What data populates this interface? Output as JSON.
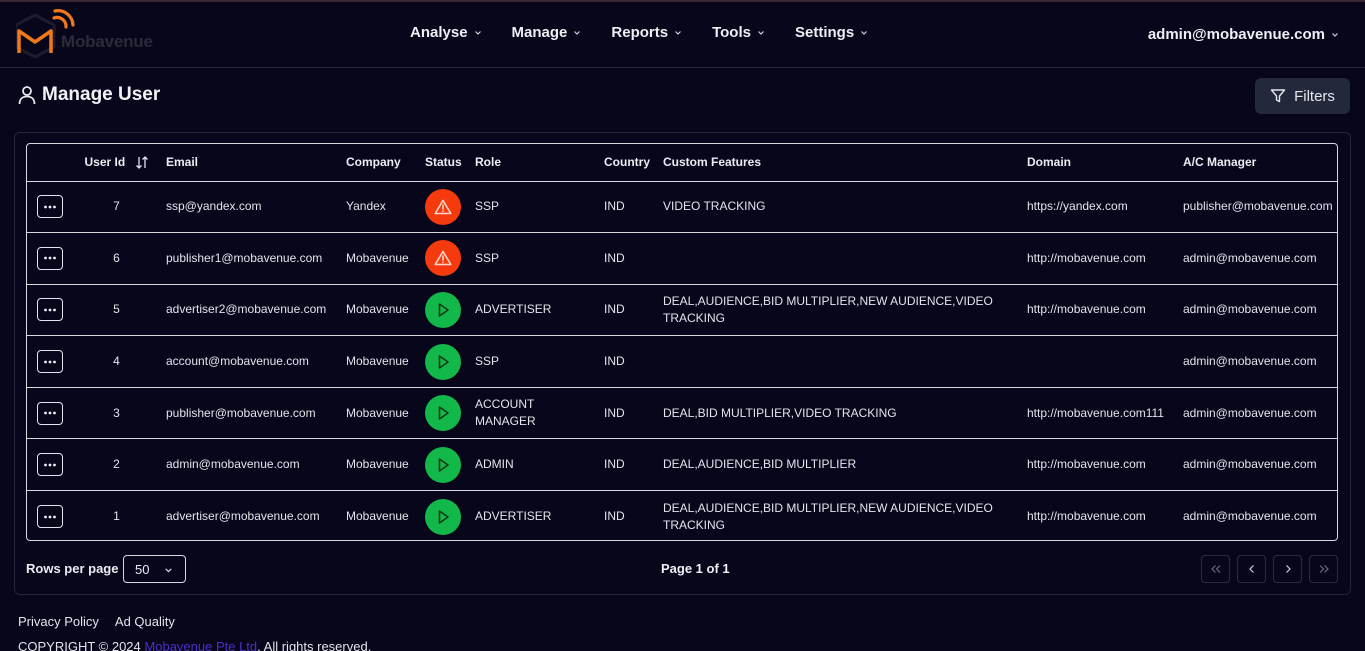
{
  "app": {
    "logo_text": "Mobavenue"
  },
  "nav": [
    {
      "label": "Analyse"
    },
    {
      "label": "Manage"
    },
    {
      "label": "Reports"
    },
    {
      "label": "Tools"
    },
    {
      "label": "Settings"
    }
  ],
  "user_menu": {
    "email": "admin@mobavenue.com"
  },
  "page": {
    "title": "Manage User",
    "filters_label": "Filters"
  },
  "table": {
    "headers": {
      "user_id": "User Id",
      "email": "Email",
      "company": "Company",
      "status": "Status",
      "role": "Role",
      "country": "Country",
      "custom_features": "Custom Features",
      "domain": "Domain",
      "ac_manager": "A/C Manager"
    },
    "rows": [
      {
        "user_id": "7",
        "email": "ssp@yandex.com",
        "company": "Yandex",
        "status": "warning",
        "role": "SSP",
        "country": "IND",
        "custom_features": "VIDEO TRACKING",
        "domain": "https://yandex.com",
        "ac_manager": "publisher@mobavenue.com"
      },
      {
        "user_id": "6",
        "email": "publisher1@mobavenue.com",
        "company": "Mobavenue",
        "status": "warning",
        "role": "SSP",
        "country": "IND",
        "custom_features": "",
        "domain": "http://mobavenue.com",
        "ac_manager": "admin@mobavenue.com"
      },
      {
        "user_id": "5",
        "email": "advertiser2@mobavenue.com",
        "company": "Mobavenue",
        "status": "active",
        "role": "ADVERTISER",
        "country": "IND",
        "custom_features": "DEAL,AUDIENCE,BID MULTIPLIER,NEW AUDIENCE,VIDEO TRACKING",
        "domain": "http://mobavenue.com",
        "ac_manager": "admin@mobavenue.com"
      },
      {
        "user_id": "4",
        "email": "account@mobavenue.com",
        "company": "Mobavenue",
        "status": "active",
        "role": "SSP",
        "country": "IND",
        "custom_features": "",
        "domain": "",
        "ac_manager": "admin@mobavenue.com"
      },
      {
        "user_id": "3",
        "email": "publisher@mobavenue.com",
        "company": "Mobavenue",
        "status": "active",
        "role": "ACCOUNT MANAGER",
        "country": "IND",
        "custom_features": "DEAL,BID MULTIPLIER,VIDEO TRACKING",
        "domain": "http://mobavenue.com111",
        "ac_manager": "admin@mobavenue.com"
      },
      {
        "user_id": "2",
        "email": "admin@mobavenue.com",
        "company": "Mobavenue",
        "status": "active",
        "role": "ADMIN",
        "country": "IND",
        "custom_features": "DEAL,AUDIENCE,BID MULTIPLIER",
        "domain": "http://mobavenue.com",
        "ac_manager": "admin@mobavenue.com"
      },
      {
        "user_id": "1",
        "email": "advertiser@mobavenue.com",
        "company": "Mobavenue",
        "status": "active",
        "role": "ADVERTISER",
        "country": "IND",
        "custom_features": "DEAL,AUDIENCE,BID MULTIPLIER,NEW AUDIENCE,VIDEO TRACKING",
        "domain": "http://mobavenue.com",
        "ac_manager": "admin@mobavenue.com"
      }
    ]
  },
  "pagination": {
    "rows_per_page_label": "Rows per page",
    "rows_per_page_value": "50",
    "page_info": "Page 1 of 1"
  },
  "footer": {
    "links": [
      "Privacy Policy",
      "Ad Quality"
    ],
    "copyright_prefix": "COPYRIGHT © 2024",
    "copyright_brand": "Mobavenue Pte Ltd",
    "copyright_suffix": ". All rights reserved."
  },
  "colors": {
    "background": "#07061a",
    "brand_orange": "#f07a1a",
    "status_warning": "#f53a0e",
    "status_active": "#13b84a",
    "link_purple": "#4b2fc9"
  },
  "icons": {
    "logo": "mobavenue-logo-icon",
    "title": "user-icon",
    "filters": "filter-icon",
    "sort": "sort-arrows-icon",
    "row_actions": "more-dots-icon",
    "status_warning": "warning-triangle-icon",
    "status_active": "play-icon"
  }
}
